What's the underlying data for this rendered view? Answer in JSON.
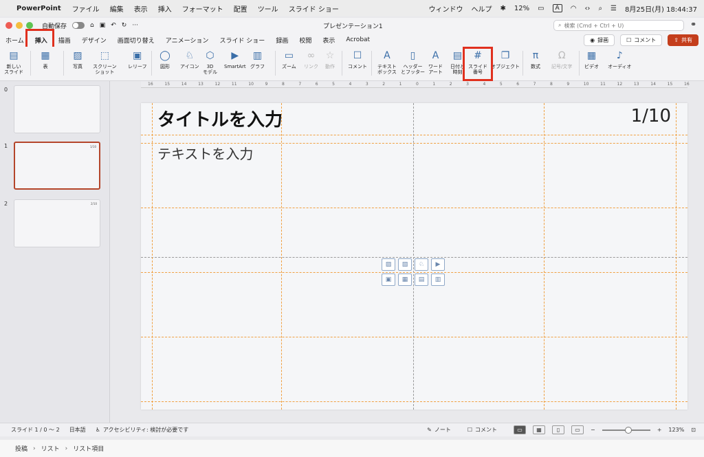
{
  "menubar": {
    "app_name": "PowerPoint",
    "items": [
      "ファイル",
      "編集",
      "表示",
      "挿入",
      "フォーマット",
      "配置",
      "ツール",
      "スライド ショー",
      "ウィンドウ",
      "ヘルプ"
    ],
    "battery": "12%",
    "input_mode": "A",
    "datetime": "8月25日(月)  18:44:37"
  },
  "titlebar": {
    "autosave_label": "自動保存",
    "doc_title": "プレゼンテーション1",
    "search_placeholder": "検索 (Cmd + Ctrl + U)",
    "more": "···"
  },
  "tabs": {
    "items": [
      "ホーム",
      "挿入",
      "描画",
      "デザイン",
      "画面切り替え",
      "アニメーション",
      "スライド ショー",
      "録画",
      "校閲",
      "表示",
      "Acrobat"
    ],
    "active": "挿入",
    "record_label": "録画",
    "comment_label": "コメント",
    "share_label": "共有"
  },
  "ribbon": {
    "new_slide": "新しい\nスライド",
    "table": "表",
    "photo": "写真",
    "screenshot": "スクリーン\nショット",
    "cameo": "レリーフ",
    "shapes": "図形",
    "icons": "アイコン",
    "model3d": "3D\nモデル",
    "smartart": "SmartArt",
    "chart": "グラフ",
    "zoom": "ズーム",
    "link": "リンク",
    "action": "動作",
    "comment": "コメント",
    "textbox": "テキスト\nボックス",
    "header_footer": "ヘッダー\nとフッター",
    "wordart": "ワード\nアート",
    "datetime": "日付と\n時刻",
    "slide_number": "スライド\n番号",
    "object": "オブジェクト",
    "equation": "数式",
    "symbol": "記号/文字",
    "video": "ビデオ",
    "audio": "オーディオ"
  },
  "ruler": {
    "ticks": [
      "16",
      "15",
      "14",
      "13",
      "12",
      "11",
      "10",
      "9",
      "8",
      "7",
      "6",
      "5",
      "4",
      "3",
      "2",
      "1",
      "0",
      "1",
      "2",
      "3",
      "4",
      "5",
      "6",
      "7",
      "8",
      "9",
      "10",
      "11",
      "12",
      "13",
      "14",
      "15",
      "16"
    ]
  },
  "thumbnails": [
    {
      "num": "0",
      "page": ""
    },
    {
      "num": "1",
      "page": "1/10"
    },
    {
      "num": "2",
      "page": "2/10"
    }
  ],
  "slide": {
    "title": "タイトルを入力",
    "page_number": "1/10",
    "body": "テキストを入力"
  },
  "status": {
    "slide_info": "スライド 1 / 0 〜 2",
    "language": "日本語",
    "accessibility": "アクセシビリティ: 検討が必要です",
    "notes": "ノート",
    "comments": "コメント",
    "zoom": "123%"
  },
  "breadcrumb": [
    "投稿",
    "リスト",
    "リスト項目"
  ]
}
